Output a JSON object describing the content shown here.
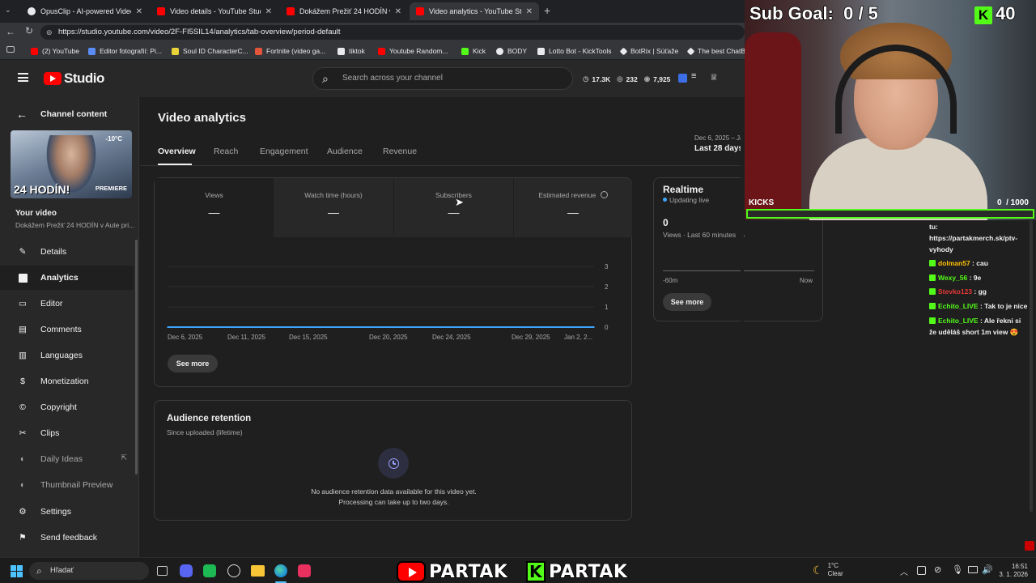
{
  "browser": {
    "tabs": [
      {
        "title": "OpusClip - AI-powered Video Rep",
        "favicon_color": "#e8eaed"
      },
      {
        "title": "Video details - YouTube Studio",
        "favicon_color": "#ff0000"
      },
      {
        "title": "Dokážem Prežiť 24 HODÍN v Aute",
        "favicon_color": "#ff0000"
      },
      {
        "title": "Video analytics - YouTube Studio",
        "favicon_color": "#ff0000"
      }
    ],
    "url": "https://studio.youtube.com/video/2F-FI5SIL14/analytics/tab-overview/period-default",
    "bookmarks": [
      {
        "label": "(2) YouTube",
        "color": "#ff0000"
      },
      {
        "label": "Editor fotografií: Pi...",
        "color": "#5b8cf5"
      },
      {
        "label": "Soul ID CharacterC...",
        "color": "#e9d23a"
      },
      {
        "label": "Fortnite (video ga...",
        "color": "#e2553a"
      },
      {
        "label": "tiktok",
        "color": "#e8eaed"
      },
      {
        "label": "Youtube Random...",
        "color": "#ff0000"
      },
      {
        "label": "Kick",
        "color": "#53fc18"
      },
      {
        "label": "BODY",
        "color": "#e8eaed"
      },
      {
        "label": "Lotto Bot - KickTools",
        "color": "#e8eaed"
      },
      {
        "label": "BotRix | Súťaže",
        "color": "#e8eaed"
      },
      {
        "label": "The best ChatBo",
        "color": "#e8eaed"
      }
    ]
  },
  "header": {
    "logo_text": "Studio",
    "search_placeholder": "Search across your channel",
    "stats": {
      "subs": "17.3K",
      "comments": "232",
      "views": "7,925"
    }
  },
  "sidebar": {
    "back_label": "Channel content",
    "thumb_text": "24 HODÍN!",
    "thumb_badge": "PREMIERE",
    "thumb_temp": "-10°C",
    "your_video_label": "Your video",
    "video_title": "Dokážem Prežiť 24 HODÍN v Aute pri...",
    "items": [
      {
        "label": "Details",
        "icon": "pencil-icon"
      },
      {
        "label": "Analytics",
        "icon": "analytics-icon"
      },
      {
        "label": "Editor",
        "icon": "editor-icon"
      },
      {
        "label": "Comments",
        "icon": "comments-icon"
      },
      {
        "label": "Languages",
        "icon": "languages-icon"
      },
      {
        "label": "Monetization",
        "icon": "monetization-icon"
      },
      {
        "label": "Copyright",
        "icon": "copyright-icon"
      },
      {
        "label": "Clips",
        "icon": "scissors-icon"
      },
      {
        "label": "Daily Ideas",
        "icon": "ideas-icon"
      },
      {
        "label": "Thumbnail Preview",
        "icon": "thumbnail-icon"
      },
      {
        "label": "Settings",
        "icon": "gear-icon"
      },
      {
        "label": "Send feedback",
        "icon": "feedback-icon"
      }
    ]
  },
  "main": {
    "title": "Video analytics",
    "date_range_text": "Dec 6, 2025 – Ja",
    "date_range_label": "Last 28 days",
    "tabs": [
      "Overview",
      "Reach",
      "Engagement",
      "Audience",
      "Revenue"
    ],
    "metrics": [
      {
        "label": "Views",
        "value": "—"
      },
      {
        "label": "Watch time (hours)",
        "value": "—"
      },
      {
        "label": "Subscribers",
        "value": "—"
      },
      {
        "label": "Estimated revenue",
        "value": "—"
      }
    ],
    "chart_y_ticks": [
      "3",
      "2",
      "1",
      "0"
    ],
    "chart_x_ticks": [
      "Dec 6, 2025",
      "Dec 11, 2025",
      "Dec 15, 2025",
      "Dec 20, 2025",
      "Dec 24, 2025",
      "Dec 29, 2025",
      "Jan 2, 2..."
    ],
    "see_more": "See more",
    "realtime": {
      "title": "Realtime",
      "status": "Updating live",
      "value": "0",
      "sub_label": "Views · Last 60 minutes",
      "axis_start": "-60m",
      "axis_end": "Now",
      "see_more": "See more"
    },
    "retention": {
      "title": "Audience retention",
      "subtitle": "Since uploaded (lifetime)",
      "empty_line1": "No audience retention data available for this video yet.",
      "empty_line2": "Processing can take up to two days."
    }
  },
  "chart_data": {
    "type": "line",
    "x": [
      "Dec 6, 2025",
      "Dec 11, 2025",
      "Dec 15, 2025",
      "Dec 20, 2025",
      "Dec 24, 2025",
      "Dec 29, 2025",
      "Jan 2, 2..."
    ],
    "series": [
      {
        "values": [
          0,
          0,
          0,
          0,
          0,
          0,
          0
        ]
      }
    ],
    "ylim": [
      0,
      3
    ],
    "grid": true
  },
  "overlay": {
    "sub_goal": "Sub Goal:  0 / 5",
    "kick_count": "40",
    "kicks_label": "KICKS",
    "kicks_value": "0  / 1000",
    "chat": [
      {
        "user": "",
        "text": "tu:",
        "color": "#f1f1f1"
      },
      {
        "user": "",
        "text": "https://partakmerch.sk/ptv-",
        "color": "#f1f1f1"
      },
      {
        "user": "",
        "text": "vyhody",
        "color": "#f1f1f1"
      },
      {
        "user": "dolman57",
        "text": " : cau",
        "color": "#ffc107"
      },
      {
        "user": "Wexy_56",
        "text": " : 9e",
        "color": "#53fc18"
      },
      {
        "user": "Stevko123",
        "text": " : gg",
        "color": "#e53935"
      },
      {
        "user": "Echito_LIVE",
        "text": " : Tak to je nice",
        "color": "#53fc18"
      },
      {
        "user": "Echito_LIVE",
        "text": " : Ale řekni si",
        "color": "#53fc18"
      },
      {
        "user": "",
        "text": "že uděláš short 1m view 😍",
        "color": "#f1f1f1"
      }
    ],
    "partak_yt": "PARTAK",
    "partak_kick": "PARTAK"
  },
  "taskbar": {
    "search_label": "Hľadať",
    "weather_temp": "1°C",
    "weather_desc": "Clear",
    "time": "16:51",
    "date": "3. 1. 2026"
  }
}
